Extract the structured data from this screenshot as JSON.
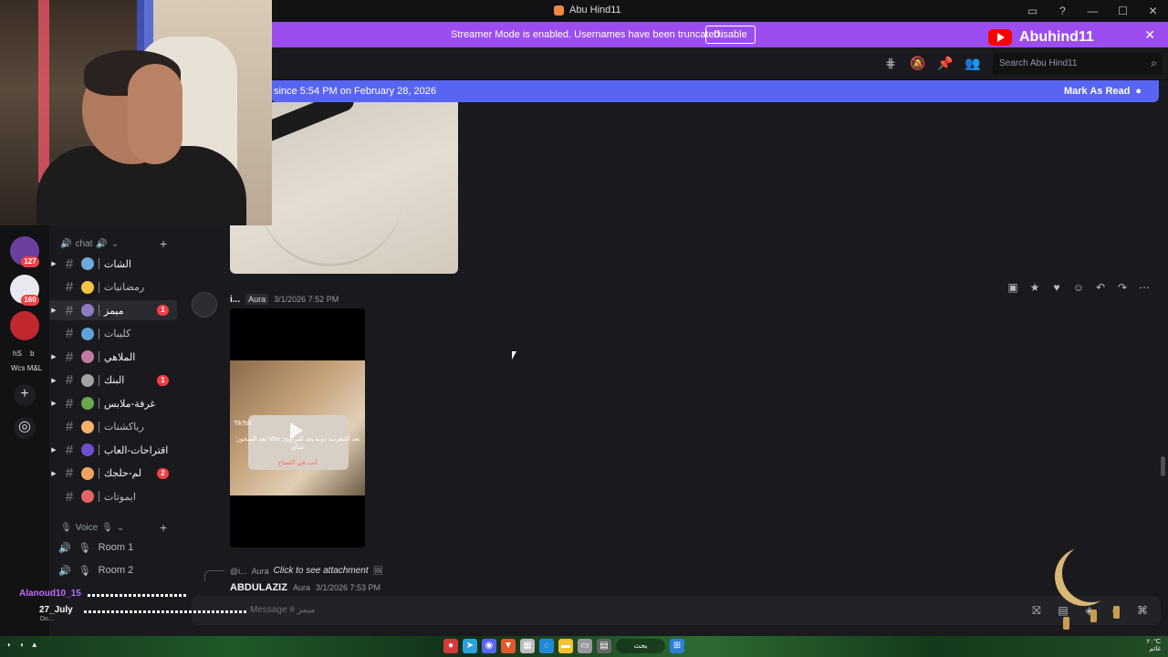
{
  "window": {
    "title": "Abu Hind11"
  },
  "streamer_banner": {
    "message": "Streamer Mode is enabled. Usernames have been truncated.",
    "disable_label": "Disable",
    "channel_name": "Abuhind11"
  },
  "header": {
    "search_placeholder": "Search Abu Hind11",
    "icons": [
      "threads-icon",
      "mute-icon",
      "pin-icon",
      "members-icon"
    ]
  },
  "new_messages_bar": {
    "since_text": "since 5:54 PM on February 28, 2026",
    "mark_label": "Mark As Read"
  },
  "server_rail": {
    "badges": [
      "127",
      "160"
    ],
    "labels": [
      "hS",
      "b",
      "Wcs M&L"
    ]
  },
  "sidebar": {
    "chat_category": "chat",
    "voice_category": "Voice",
    "channels": [
      {
        "name": "الشات",
        "unread": true,
        "count": ""
      },
      {
        "name": "رمضانيات",
        "unread": false,
        "count": ""
      },
      {
        "name": "ميمز",
        "unread": true,
        "count": "1",
        "active": true
      },
      {
        "name": "كليبات",
        "unread": false,
        "count": ""
      },
      {
        "name": "الملاهي",
        "unread": true,
        "count": ""
      },
      {
        "name": "البنك",
        "unread": true,
        "count": "1"
      },
      {
        "name": "غرفة-ملابس",
        "unread": true,
        "count": ""
      },
      {
        "name": "رياكشنات",
        "unread": false,
        "count": ""
      },
      {
        "name": "اقتراحات-العاب",
        "unread": true,
        "count": ""
      },
      {
        "name": "لم-حلجك",
        "unread": true,
        "count": "2"
      },
      {
        "name": "ايموتات",
        "unread": false,
        "count": ""
      }
    ],
    "voice_channels": [
      "Room 1",
      "Room 2"
    ]
  },
  "message": {
    "username": "i...",
    "tag": "Aura",
    "timestamp": "3/1/2026 7:52 PM",
    "video_caption": "بعد المغرب: دوبة بعد التراويح: Vbu بعد السحور: شاي",
    "video_caption_2": "أنت في الصباح",
    "video_watermark": "TikTok"
  },
  "reply_preview": {
    "mention": "@i...",
    "tag": "Aura",
    "text": "Click to see attachment"
  },
  "next_message": {
    "username": "ABDULAZIZ",
    "tag": "Aura",
    "timestamp": "3/1/2026 7:53 PM"
  },
  "composer": {
    "placeholder": "Message # ميمز"
  },
  "overlay": {
    "user1": "Alanoud10_15",
    "user2": "27_July",
    "sub": "Do..."
  },
  "taskbar": {
    "search_label": "بحث",
    "clock_line1": "٢٠°C",
    "clock_line2": "غائم"
  },
  "colors": {
    "accent": "#5865f2",
    "streamer": "#9b4df0",
    "badge": "#f23f43"
  }
}
